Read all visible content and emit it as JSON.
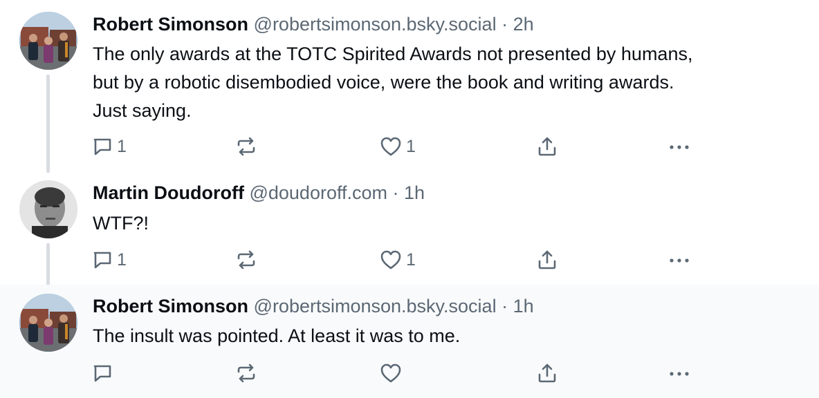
{
  "posts": [
    {
      "author": "Robert Simonson",
      "handle": "@robertsimonson.bsky.social",
      "separator": "·",
      "time": "2h",
      "lines": [
        "The only awards at the TOTC Spirited Awards not presented by humans,",
        "but by a robotic disembodied voice, were the book and writing awards.",
        "Just saying."
      ],
      "replies": "1",
      "reposts": "",
      "likes": "1"
    },
    {
      "author": "Martin Doudoroff",
      "handle": "@doudoroff.com",
      "separator": "·",
      "time": "1h",
      "lines": [
        "WTF?!"
      ],
      "replies": "1",
      "reposts": "",
      "likes": "1"
    },
    {
      "author": "Robert Simonson",
      "handle": "@robertsimonson.bsky.social",
      "separator": "·",
      "time": "1h",
      "lines": [
        "The insult was pointed. At least it was to me."
      ],
      "replies": "",
      "reposts": "",
      "likes": ""
    }
  ],
  "icons": {
    "reply": "reply-icon",
    "repost": "repost-icon",
    "like": "heart-icon",
    "share": "share-icon",
    "more": "more-icon"
  },
  "colors": {
    "text": "#0b0f14",
    "muted": "#5b6874",
    "thread_line": "#d9dde2",
    "highlight_bg": "#f9fafb"
  }
}
